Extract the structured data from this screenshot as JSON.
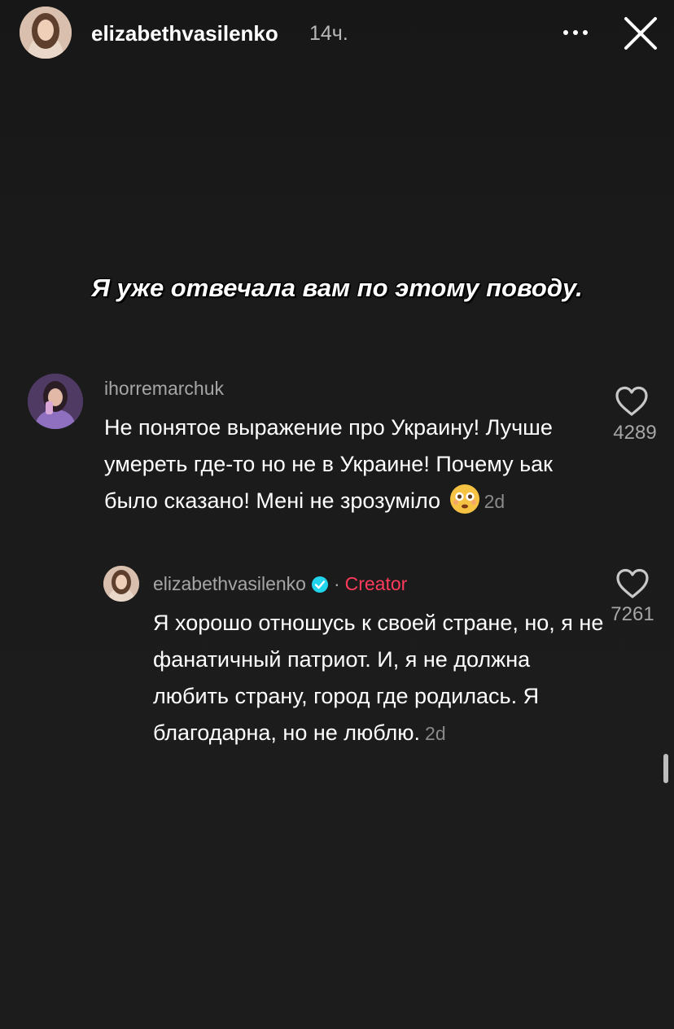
{
  "header": {
    "username": "elizabethvasilenko",
    "time": "14ч."
  },
  "story": {
    "caption": "Я уже отвечала вам по этому поводу."
  },
  "comment": {
    "username": "ihorremarchuk",
    "text": "Не понятое выражение про Украину! Лучше умереть где-то но не в Украине! Почему ьак было сказано! Мені не зрозуміло",
    "time": "2d",
    "likes": "4289"
  },
  "reply": {
    "username": "elizabethvasilenko",
    "separator": "·",
    "badge": "Creator",
    "text": "Я хорошо отношусь к своей стране, но, я не фанатичный патриот. И, я не должна любить страну, город где родилась. Я благодарна, но не люблю.",
    "time": "2d",
    "likes": "7261"
  },
  "colors": {
    "background": "#1c1c1c",
    "creator": "#ff3b5c",
    "verified": "#20d5ec",
    "muted": "#a6a6a6"
  },
  "icons": [
    "more-icon",
    "close-icon",
    "heart-icon",
    "verified-badge-icon",
    "flushed-face-emoji"
  ]
}
